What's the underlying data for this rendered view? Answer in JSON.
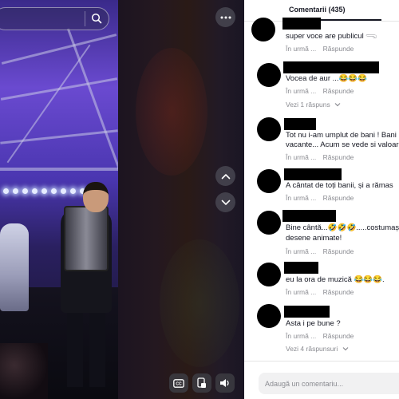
{
  "search": {
    "placeholder": ""
  },
  "video": {
    "icons": {
      "search": "search-icon",
      "more": "more-horizontal-icon",
      "up": "chevron-up-icon",
      "down": "chevron-down-icon",
      "captions": "closed-captions-icon",
      "pip": "picture-in-picture-icon",
      "volume": "volume-icon"
    }
  },
  "panel": {
    "tab_label": "Comentarii (435)",
    "input_placeholder": "Adaugă un comentariu...",
    "comments": [
      {
        "text": "super voce are publicul 𓂸",
        "time": "În urmă ...",
        "reply": "Răspunde"
      },
      {
        "text": "Vocea de aur ...😂😂😂",
        "time": "În urmă ...",
        "reply": "Răspunde",
        "view_replies": "Vezi 1 răspuns"
      },
      {
        "text": "Tot nu i-am umplut de bani ! Bani",
        "text2": "vacante... Acum se vede si valoare",
        "time": "În urmă ...",
        "reply": "Răspunde"
      },
      {
        "text": "A cântat de toți banii, și a rămas",
        "time": "În urmă ...",
        "reply": "Răspunde"
      },
      {
        "text": "Bine cântă...🤣🤣🤣.....costumașe",
        "text2": "desene animate!",
        "time": "În urmă ...",
        "reply": "Răspunde"
      },
      {
        "text": "eu la ora de muzică 😂😂😂.",
        "time": "În urmă ...",
        "reply": "Răspunde"
      },
      {
        "text": "Asta i pe bune ?",
        "time": "În urmă ...",
        "reply": "Răspunde",
        "view_replies": "Vezi 4 răspunsuri"
      }
    ]
  },
  "colors": {
    "panel_bg": "#ffffff",
    "text": "#161823",
    "muted": "#8a8b91",
    "redaction": "#000000"
  }
}
